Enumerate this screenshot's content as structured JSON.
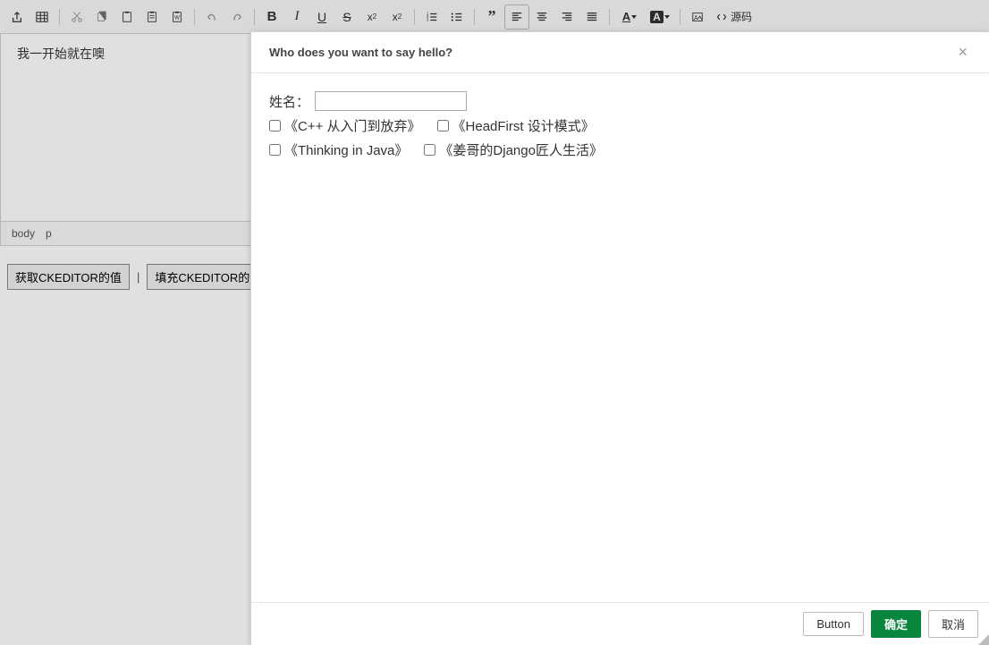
{
  "toolbar": {
    "source_label": "源码"
  },
  "editor": {
    "content": "我一开始就在噢"
  },
  "statusbar": {
    "path1": "body",
    "path2": "p"
  },
  "buttons": {
    "get_value": "获取CKEDITOR的值",
    "fill_value": "填充CKEDITOR的值"
  },
  "dialog": {
    "title": "Who does you want to say hello?",
    "name_label": "姓名：",
    "options": [
      "《C++ 从入门到放弃》",
      "《HeadFirst 设计模式》",
      "《Thinking in Java》",
      "《姜哥的Django匠人生活》"
    ],
    "footer": {
      "button": "Button",
      "ok": "确定",
      "cancel": "取消"
    }
  }
}
